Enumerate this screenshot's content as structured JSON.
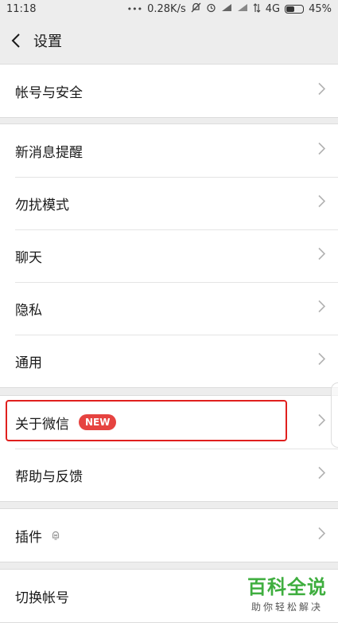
{
  "status_bar": {
    "time": "11:18",
    "net_speed": "0.28K/s",
    "network": "4G",
    "battery": "45%"
  },
  "header": {
    "title": "设置"
  },
  "groups": [
    {
      "items": [
        {
          "label": "帐号与安全"
        }
      ]
    },
    {
      "items": [
        {
          "label": "新消息提醒"
        },
        {
          "label": "勿扰模式"
        },
        {
          "label": "聊天"
        },
        {
          "label": "隐私"
        },
        {
          "label": "通用"
        }
      ]
    },
    {
      "items": [
        {
          "label": "关于微信",
          "badge": "NEW"
        },
        {
          "label": "帮助与反馈"
        }
      ]
    },
    {
      "items": [
        {
          "label": "插件"
        }
      ]
    },
    {
      "items": [
        {
          "label": "切换帐号"
        }
      ]
    }
  ],
  "watermark": {
    "title": "百科全说",
    "subtitle": "助你轻松解决"
  },
  "colors": {
    "badge": "#e64340",
    "highlight": "#e0201e",
    "watermark": "#3fae3f"
  }
}
